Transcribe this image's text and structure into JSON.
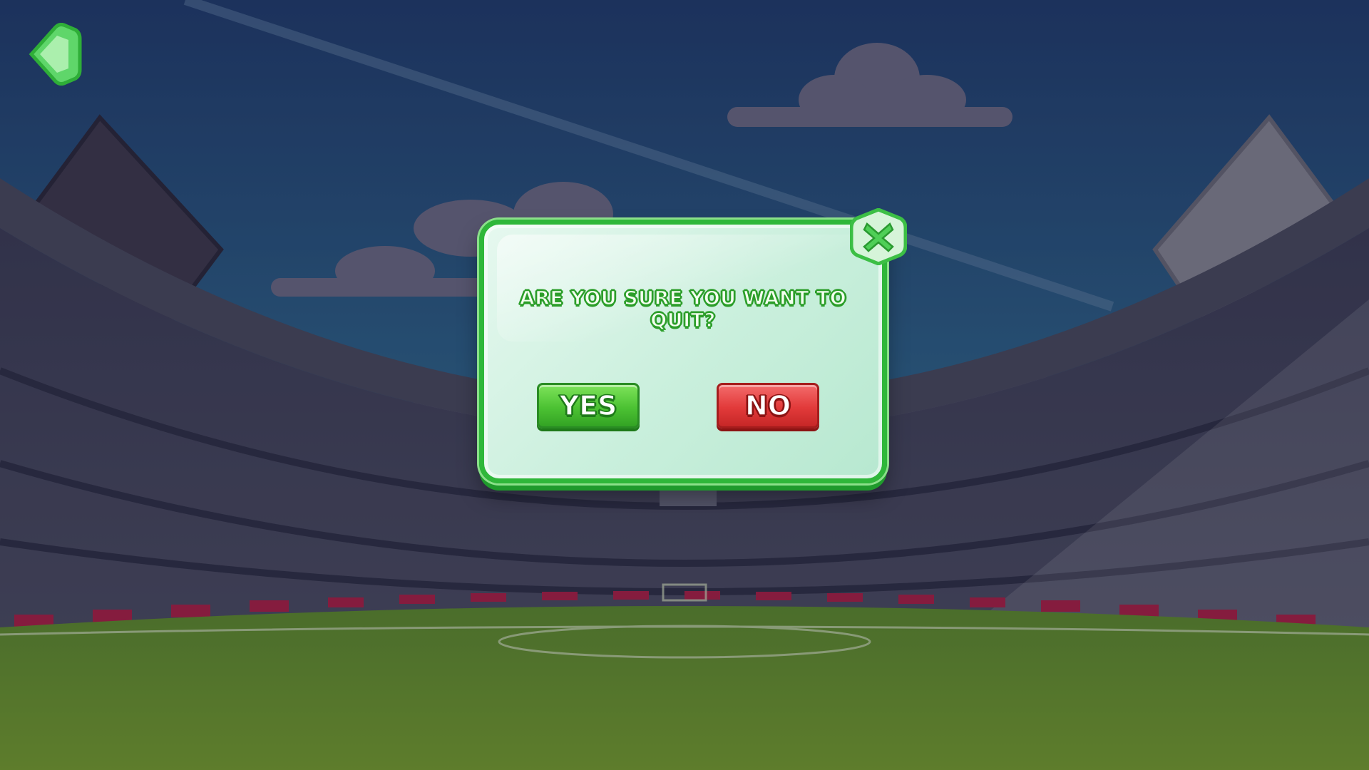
{
  "dialog": {
    "title": "ARE YOU SURE YOU WANT TO QUIT?",
    "yes_label": "YES",
    "no_label": "NO"
  },
  "icons": {
    "back": "back-arrow-icon",
    "close": "close-x-icon"
  },
  "colors": {
    "accent_green": "#2fb73a",
    "yes_green": "#4cc233",
    "no_red": "#e23a3a",
    "dialog_bg": "#c9efdc"
  }
}
